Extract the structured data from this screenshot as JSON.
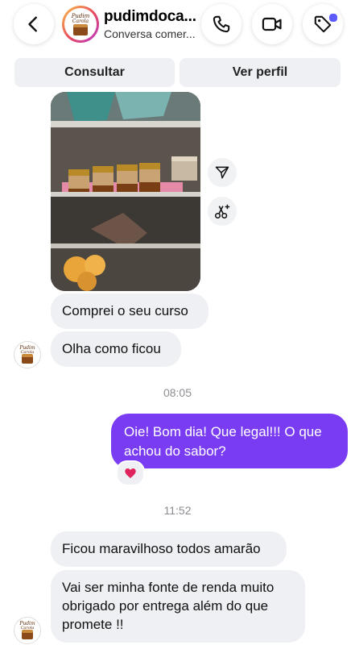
{
  "header": {
    "title": "pudimdoca...",
    "subtitle": "Conversa comer...",
    "avatar_text_line1": "Pudim",
    "avatar_text_line2": "Carola"
  },
  "actions": {
    "consultar": "Consultar",
    "ver_perfil": "Ver perfil"
  },
  "messages": [
    {
      "from": "them",
      "text": "Comprei o seu curso"
    },
    {
      "from": "them",
      "text": "Olha como ficou"
    },
    {
      "from": "time",
      "text": "08:05"
    },
    {
      "from": "me",
      "text": "Oie! Bom dia! Que legal!!! O que achou do sabor?",
      "reaction": "❤️"
    },
    {
      "from": "time",
      "text": "11:52"
    },
    {
      "from": "them",
      "text": "Ficou maravilhoso todos amarão"
    },
    {
      "from": "them",
      "text": "Vai ser minha fonte de renda muito obrigado por entrega além do que promete !!"
    }
  ],
  "colors": {
    "outgoing_bubble": "#7a3cf2",
    "incoming_bubble": "#eef0f3",
    "badge": "#5b5bff"
  }
}
